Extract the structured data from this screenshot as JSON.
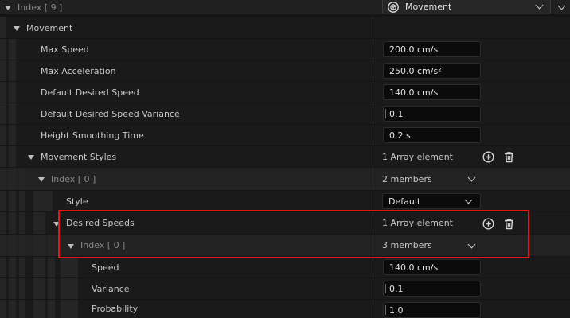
{
  "header": {
    "index_label": "Index [ 9 ]",
    "type_value": "Movement"
  },
  "movement": {
    "label": "Movement",
    "max_speed": {
      "label": "Max Speed",
      "value": "200.0 cm/s"
    },
    "max_acceleration": {
      "label": "Max Acceleration",
      "value": "250.0 cm/s²"
    },
    "default_desired_speed": {
      "label": "Default Desired Speed",
      "value": "140.0 cm/s"
    },
    "default_desired_speed_variance": {
      "label": "Default Desired Speed Variance",
      "value": "0.1"
    },
    "height_smoothing_time": {
      "label": "Height Smoothing Time",
      "value": "0.2 s"
    }
  },
  "movement_styles": {
    "label": "Movement Styles",
    "summary": "1 Array element",
    "index0": {
      "label": "Index [ 0 ]",
      "summary": "2 members"
    },
    "style": {
      "label": "Style",
      "value": "Default"
    },
    "desired_speeds": {
      "label": "Desired Speeds",
      "summary": "1 Array element",
      "index0": {
        "label": "Index [ 0 ]",
        "summary": "3 members"
      },
      "speed": {
        "label": "Speed",
        "value": "140.0 cm/s"
      },
      "variance": {
        "label": "Variance",
        "value": "0.1"
      },
      "probability": {
        "label": "Probability",
        "value": "1.0"
      }
    }
  },
  "colors": {
    "background": "#151515",
    "highlight_border": "#e5161c"
  },
  "icons": [
    "expand-triangle-icon",
    "movement-type-icon",
    "chevron-down-icon",
    "add-element-icon",
    "trash-icon"
  ]
}
